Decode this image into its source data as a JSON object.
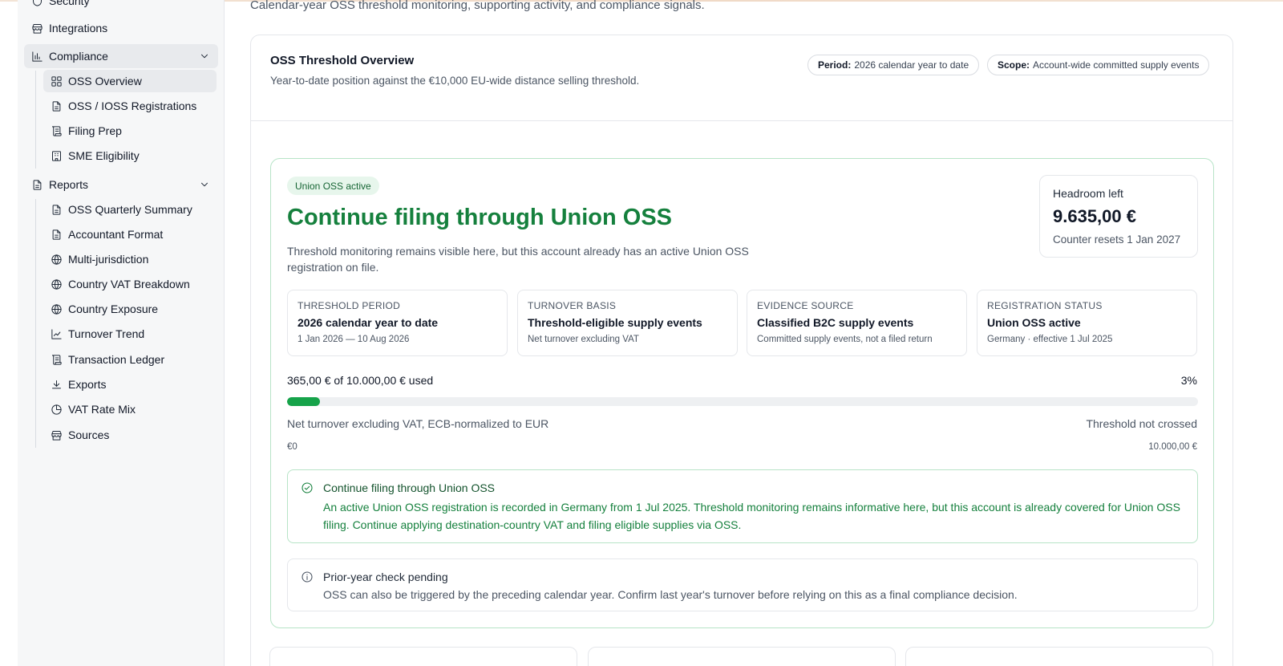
{
  "sidebar": {
    "top_items": [
      {
        "label": "Security",
        "icon": "shield-icon"
      },
      {
        "label": "Integrations",
        "icon": "store-icon"
      }
    ],
    "compliance": {
      "label": "Compliance",
      "icon": "bar-chart-icon",
      "items": [
        {
          "label": "OSS Overview",
          "icon": "layout-grid-icon"
        },
        {
          "label": "OSS / IOSS Registrations",
          "icon": "file-text-icon"
        },
        {
          "label": "Filing Prep",
          "icon": "scroll-icon"
        },
        {
          "label": "SME Eligibility",
          "icon": "building-icon"
        }
      ]
    },
    "reports": {
      "label": "Reports",
      "icon": "file-text-icon",
      "items": [
        {
          "label": "OSS Quarterly Summary",
          "icon": "file-text-icon"
        },
        {
          "label": "Accountant Format",
          "icon": "file-text-icon"
        },
        {
          "label": "Multi-jurisdiction",
          "icon": "globe-icon"
        },
        {
          "label": "Country VAT Breakdown",
          "icon": "globe-icon"
        },
        {
          "label": "Country Exposure",
          "icon": "globe-icon"
        },
        {
          "label": "Turnover Trend",
          "icon": "line-chart-icon"
        },
        {
          "label": "Transaction Ledger",
          "icon": "scroll-icon"
        },
        {
          "label": "Exports",
          "icon": "download-icon"
        },
        {
          "label": "VAT Rate Mix",
          "icon": "pie-chart-icon"
        },
        {
          "label": "Sources",
          "icon": "store-icon"
        }
      ]
    }
  },
  "page": {
    "subtitle": "Calendar-year OSS threshold monitoring, supporting activity, and compliance signals."
  },
  "overview": {
    "title": "OSS Threshold Overview",
    "description": "Year-to-date position against the €10,000 EU-wide distance selling threshold.",
    "period_label": "Period:",
    "period_value": "2026 calendar year to date",
    "scope_label": "Scope:",
    "scope_value": "Account-wide committed supply events"
  },
  "status": {
    "badge": "Union OSS active",
    "title": "Continue filing through Union OSS",
    "lead": "Threshold monitoring remains visible here, but this account already has an active Union OSS registration on file.",
    "headroom_label": "Headroom left",
    "headroom_value": "9.635,00 €",
    "headroom_note": "Counter resets 1 Jan 2027",
    "facts": [
      {
        "key": "THRESHOLD PERIOD",
        "value": "2026 calendar year to date",
        "note": "1 Jan 2026 — 10 Aug 2026"
      },
      {
        "key": "TURNOVER BASIS",
        "value": "Threshold-eligible supply events",
        "note": "Net turnover excluding VAT"
      },
      {
        "key": "EVIDENCE SOURCE",
        "value": "Classified B2C supply events",
        "note": "Committed supply events, not a filed return"
      },
      {
        "key": "REGISTRATION STATUS",
        "value": "Union OSS active",
        "note": "Germany · effective 1 Jul 2025"
      }
    ],
    "usage_label": "365,00 € of 10.000,00 € used",
    "usage_percent_label": "3%",
    "usage_fraction": 0.0365,
    "bar_left_label": "Net turnover excluding VAT, ECB-normalized to EUR",
    "bar_right_label": "Threshold not crossed",
    "scale_min": "€0",
    "scale_max": "10.000,00 €",
    "alerts": [
      {
        "icon": "check-circle-icon",
        "title": "Continue filing through Union OSS",
        "body": "An active Union OSS registration is recorded in Germany from 1 Jul 2025. Threshold monitoring remains informative here, but this account is already covered for Union OSS filing. Continue applying destination-country VAT and filing eligible supplies via OSS."
      },
      {
        "icon": "info-icon",
        "title": "Prior-year check pending",
        "body": "OSS can also be triggered by the preceding calendar year. Confirm last year's turnover before relying on this as a final compliance decision."
      }
    ]
  },
  "colors": {
    "accent_green": "#15803d",
    "bar_green": "#16a34a",
    "success_border": "#b7e4c7",
    "sidebar_bg": "#f6f7f8"
  }
}
